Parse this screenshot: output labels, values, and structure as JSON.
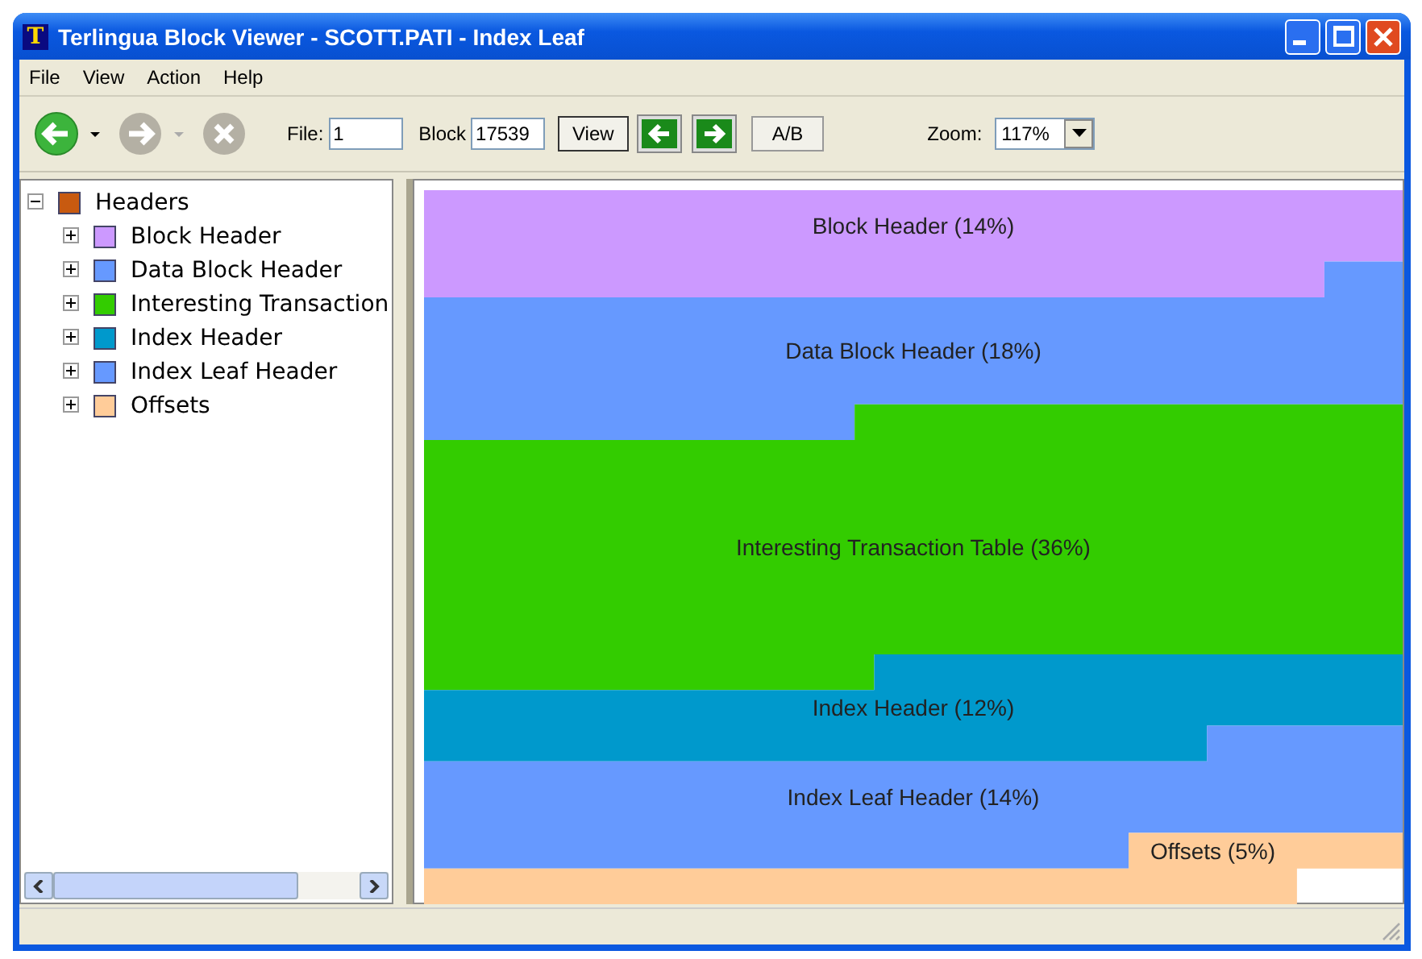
{
  "window": {
    "title": "Terlingua Block Viewer - SCOTT.PATI - Index Leaf",
    "icon_letter": "T"
  },
  "menu": [
    "File",
    "View",
    "Action",
    "Help"
  ],
  "toolbar": {
    "file_label": "File:",
    "file_value": "1",
    "block_label": "Block",
    "block_value": "17539",
    "view_button": "View",
    "ab_button": "A/B",
    "zoom_label": "Zoom:",
    "zoom_value": "117%"
  },
  "tree": {
    "label": "Headers",
    "color": "#c85a10",
    "expanded": true,
    "children": [
      {
        "label": "Block Header",
        "color": "#cc99ff",
        "expanded": false
      },
      {
        "label": "Data Block Header",
        "color": "#6699ff",
        "expanded": false
      },
      {
        "label": "Interesting Transaction",
        "color": "#33cc00",
        "expanded": false
      },
      {
        "label": "Index Header",
        "color": "#0099cc",
        "expanded": false
      },
      {
        "label": "Index Leaf Header",
        "color": "#6699ff",
        "expanded": false
      },
      {
        "label": "Offsets",
        "color": "#ffcc99",
        "expanded": false
      }
    ]
  },
  "block_map": [
    {
      "label": "Block Header (14%)",
      "color": "#cc99ff"
    },
    {
      "label": "Data Block Header (18%)",
      "color": "#6699ff"
    },
    {
      "label": "Interesting Transaction Table (36%)",
      "color": "#33cc00"
    },
    {
      "label": "Index Header (12%)",
      "color": "#0099cc"
    },
    {
      "label": "Index Leaf Header (14%)",
      "color": "#6699ff"
    },
    {
      "label": "Offsets (5%)",
      "color": "#ffcc99"
    }
  ]
}
